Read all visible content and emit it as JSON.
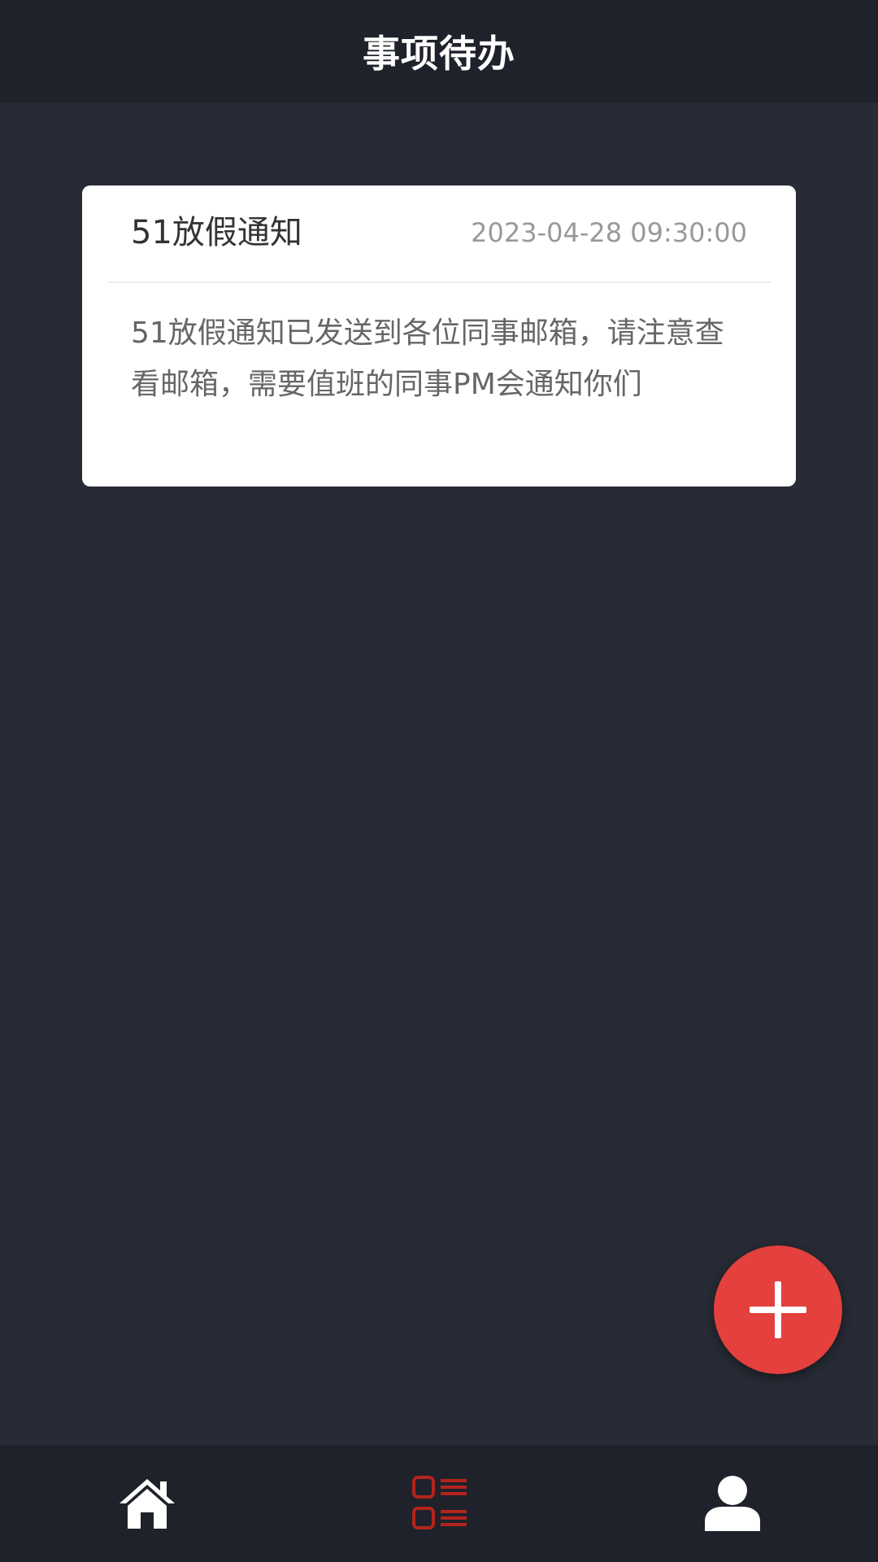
{
  "header": {
    "title": "事项待办"
  },
  "todos": [
    {
      "title": "51放假通知",
      "time": "2023-04-28 09:30:00",
      "content": "51放假通知已发送到各位同事邮箱，请注意查看邮箱，需要值班的同事PM会通知你们"
    }
  ],
  "fab": {
    "icon": "plus-icon",
    "color": "#e3403e"
  },
  "tabbar": {
    "items": [
      {
        "icon": "home-icon",
        "active": false
      },
      {
        "icon": "list-icon",
        "active": true
      },
      {
        "icon": "user-icon",
        "active": false
      }
    ],
    "active_color": "#b3241c",
    "inactive_color": "#ffffff"
  },
  "colors": {
    "background": "#272b35",
    "bar": "#1f222b",
    "card": "#ffffff"
  }
}
